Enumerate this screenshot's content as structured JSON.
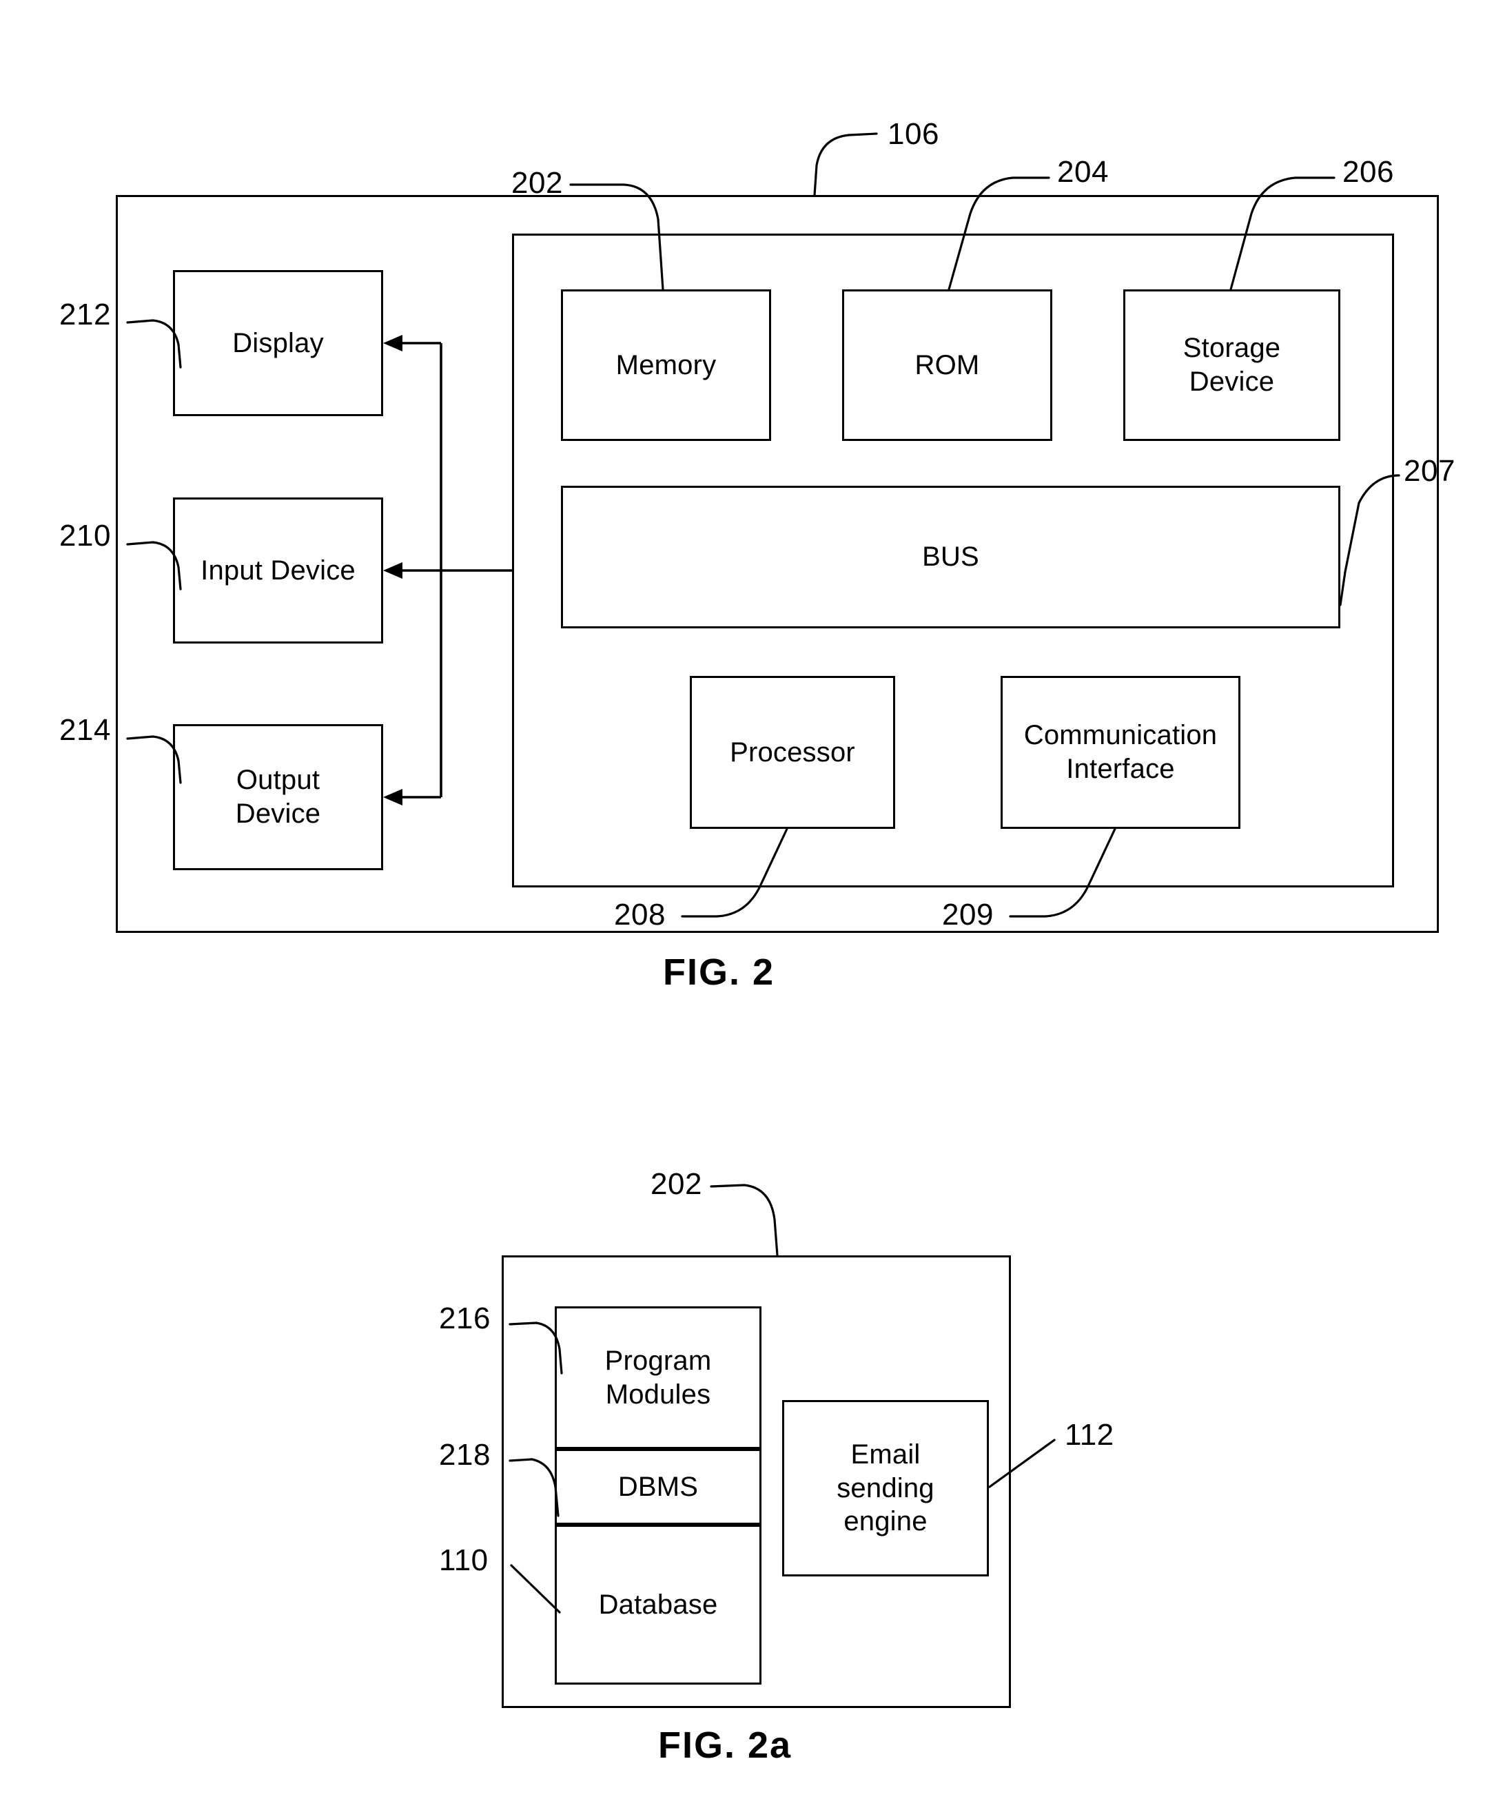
{
  "document": {
    "kind": "patent-drawing-sheet",
    "figures": [
      {
        "caption": "FIG. 2",
        "outer_ref": "106",
        "inner_ref": "202",
        "refs": {
          "r106": "106",
          "r202": "202",
          "r204": "204",
          "r206": "206",
          "r207": "207",
          "r208": "208",
          "r209": "209",
          "r210": "210",
          "r212": "212",
          "r214": "214"
        },
        "peripherals": [
          {
            "key": "display",
            "label": "Display",
            "ref": "212"
          },
          {
            "key": "input_device",
            "label": "Input Device",
            "ref": "210"
          },
          {
            "key": "output_device",
            "label": "Output\nDevice",
            "ref": "214"
          }
        ],
        "internals": [
          {
            "key": "memory",
            "label": "Memory",
            "ref": "202"
          },
          {
            "key": "rom",
            "label": "ROM",
            "ref": "204"
          },
          {
            "key": "storage_device",
            "label": "Storage\nDevice",
            "ref": "206"
          },
          {
            "key": "bus",
            "label": "BUS",
            "ref": "207"
          },
          {
            "key": "processor",
            "label": "Processor",
            "ref": "208"
          },
          {
            "key": "communication_interface",
            "label": "Communication\nInterface",
            "ref": "209"
          }
        ]
      },
      {
        "caption": "FIG. 2a",
        "outer_ref": "202",
        "refs": {
          "r202": "202",
          "r216": "216",
          "r218": "218",
          "r110": "110",
          "r112": "112"
        },
        "stack": [
          {
            "key": "program_modules",
            "label": "Program\nModules",
            "ref": "216"
          },
          {
            "key": "dbms",
            "label": "DBMS",
            "ref": "218"
          },
          {
            "key": "database",
            "label": "Database",
            "ref": "110"
          }
        ],
        "side": [
          {
            "key": "email_sending_engine",
            "label": "Email\nsending\nengine",
            "ref": "112"
          }
        ]
      }
    ]
  },
  "fig2": {
    "caption": "FIG. 2",
    "box_display": "Display",
    "box_input_device": "Input Device",
    "box_output_device_line1": "Output",
    "box_output_device_line2": "Device",
    "box_memory": "Memory",
    "box_rom": "ROM",
    "box_storage_line1": "Storage",
    "box_storage_line2": "Device",
    "box_bus": "BUS",
    "box_processor": "Processor",
    "box_comm_line1": "Communication",
    "box_comm_line2": "Interface",
    "ref_106": "106",
    "ref_202": "202",
    "ref_204": "204",
    "ref_206": "206",
    "ref_207": "207",
    "ref_208": "208",
    "ref_209": "209",
    "ref_210": "210",
    "ref_212": "212",
    "ref_214": "214"
  },
  "fig2a": {
    "caption": "FIG. 2a",
    "box_program_modules_line1": "Program",
    "box_program_modules_line2": "Modules",
    "box_dbms": "DBMS",
    "box_database": "Database",
    "box_email_line1": "Email",
    "box_email_line2": "sending",
    "box_email_line3": "engine",
    "ref_202": "202",
    "ref_216": "216",
    "ref_218": "218",
    "ref_110": "110",
    "ref_112": "112"
  },
  "style": {
    "line_color": "#000000",
    "background": "#ffffff"
  }
}
